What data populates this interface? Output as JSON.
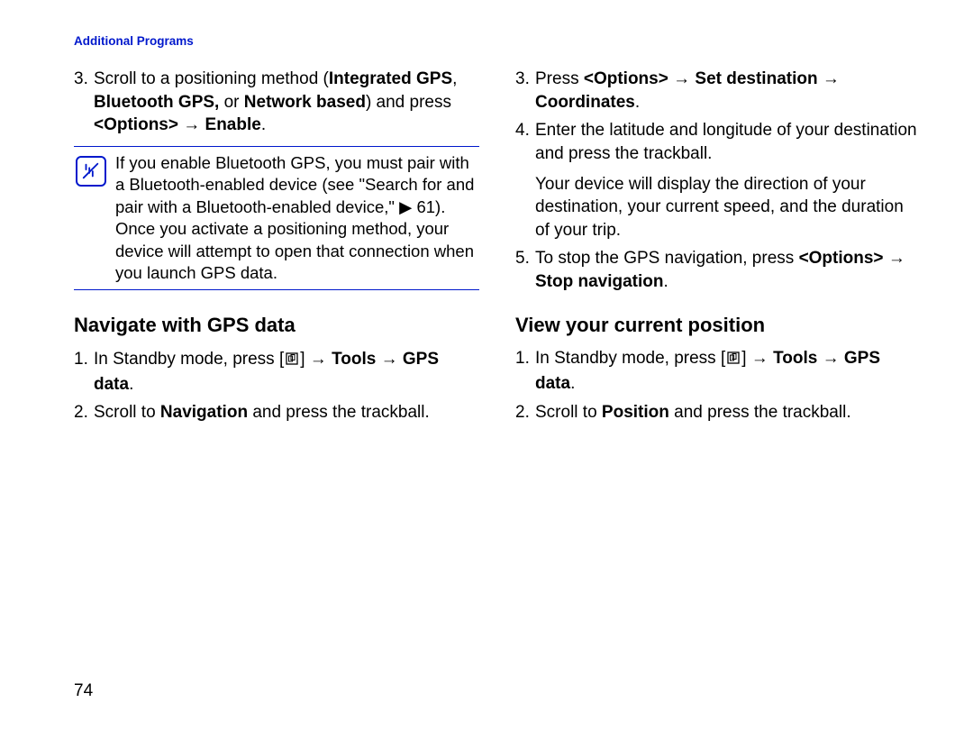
{
  "header": {
    "title": "Additional Programs"
  },
  "page_number": "74",
  "symbols": {
    "arrow": "→",
    "tri": "▶"
  },
  "left": {
    "step3": {
      "num": "3.",
      "pre": "Scroll to a positioning method (",
      "b_igps": "Integrated GPS",
      "sep1": ", ",
      "b_bgps": "Bluetooth GPS,",
      "sep2": " or ",
      "b_net": "Network based",
      "mid": ") and press ",
      "b_opts": "<Options>",
      "arr": " → ",
      "b_enable": "Enable",
      "end": "."
    },
    "note": "If you enable Bluetooth GPS, you must pair with a Bluetooth-enabled device (see \"Search for and pair with a Bluetooth-enabled device,\" ",
    "note_ref": " 61). Once you activate a positioning method, your device will attempt to open that connection when you launch GPS data.",
    "heading": "Navigate with GPS data",
    "nav1": {
      "num": "1.",
      "pre": "In Standby mode, press [",
      "post": "] ",
      "b_tools": "Tools",
      "b_gps": "GPS data",
      "end": "."
    },
    "nav2": {
      "num": "2.",
      "pre": "Scroll to ",
      "b_nav": "Navigation",
      "post": " and press the trackball."
    }
  },
  "right": {
    "step3": {
      "num": "3.",
      "pre": "Press ",
      "b_opts": "<Options>",
      "b_setdest": "Set destination",
      "b_coord": "Coordinates",
      "end": "."
    },
    "step4": {
      "num": "4.",
      "p1": "Enter the latitude and longitude of your destination and press the trackball.",
      "p2": "Your device will display the direction of your destination, your current speed, and the duration of your trip."
    },
    "step5": {
      "num": "5.",
      "pre": "To stop the GPS navigation, press ",
      "b_opts": "<Options>",
      "b_stop": "Stop navigation",
      "end": "."
    },
    "heading": "View your current position",
    "view1": {
      "num": "1.",
      "pre": "In Standby mode, press [",
      "post": "] ",
      "b_tools": "Tools",
      "b_gps": "GPS data",
      "end": "."
    },
    "view2": {
      "num": "2.",
      "pre": "Scroll to ",
      "b_pos": "Position",
      "post": " and press the trackball."
    }
  }
}
